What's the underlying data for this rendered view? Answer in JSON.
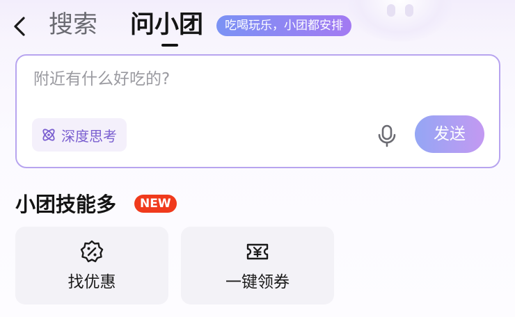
{
  "header": {
    "back_icon": "chevron-left-icon",
    "tab_search": "搜索",
    "tab_ask": "问小团",
    "slogan": "吃喝玩乐，小团都安排"
  },
  "search": {
    "placeholder": "附近有什么好吃的?",
    "value": "",
    "deep_think_label": "深度思考",
    "deep_think_icon": "atom-icon",
    "mic_icon": "microphone-icon",
    "send_label": "发送"
  },
  "skills": {
    "title": "小团技能多",
    "new_badge": "NEW",
    "items": [
      {
        "label": "找优惠",
        "icon": "discount-badge-icon"
      },
      {
        "label": "一键领券",
        "icon": "coupon-ticket-icon"
      }
    ]
  },
  "colors": {
    "accent_purple": "#7a5fd0",
    "card_border": "#b7a4ef",
    "badge_gradient_start": "#7b92f4",
    "badge_gradient_end": "#a37af2",
    "send_gradient_start": "#94a6f4",
    "send_gradient_end": "#c399f2",
    "new_badge": "#f03a1c"
  }
}
